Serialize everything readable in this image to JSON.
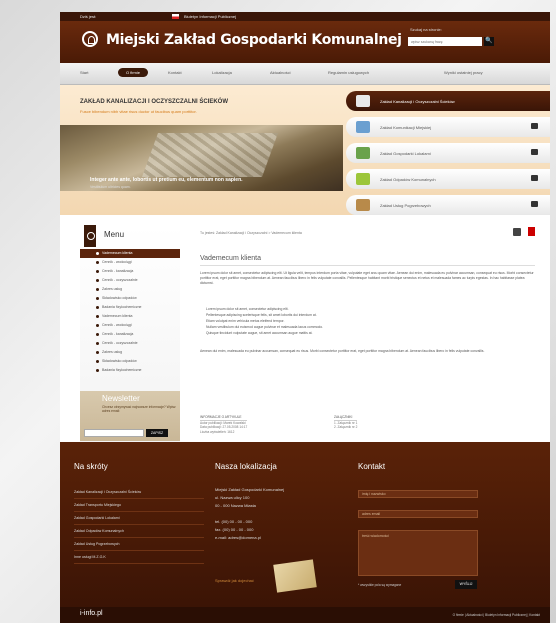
{
  "topbar": {
    "date_label": "Dziś jest:",
    "date_value": "",
    "bip_label": "Biuletyn Informacji Publicznej"
  },
  "header": {
    "title": "Miejski Zakład Gospodarki Komunalnej",
    "search_label": "Szukaj na stronie:",
    "search_placeholder": "wpisz szukaną frazę",
    "search_button": "🔍"
  },
  "nav": [
    "Start",
    "O firmie",
    "Kontakt",
    "Lokalizacja",
    "Aktualności",
    "Regulamin usługowych",
    "Wyniki ostatniej pracy"
  ],
  "slider": {
    "title": "ZAKŁAD KANALIZACJI I OCZYSZCZALNI ŚCIEKÓW",
    "subtitle": "Fusce bibendum nibh vitae risus ductor ut faucibus quam porttitor.",
    "caption": "Integer ante ante, lobortis ut pretium eu, elementum non sapien.",
    "caption_sub": "Vestibulum ultricies quam."
  },
  "tabs": [
    {
      "label": "Zakład Kanalizacji i Oczyszczalni Ścieków",
      "color": "#e8e8e8"
    },
    {
      "label": "Zakład Komunikacji Miejskiej",
      "color": "#6a9fd0"
    },
    {
      "label": "Zakład Gospodarki Lokalami",
      "color": "#6aa24b"
    },
    {
      "label": "Zakład Odpadów Komunalnych",
      "color": "#9cc63a"
    },
    {
      "label": "Zakład Usług Pogrzebowych",
      "color": "#b88a4a"
    }
  ],
  "menu": {
    "title": "Menu",
    "items": [
      "Vademecum klienta",
      "Cennik - wodociągi",
      "Cennik - kanalizacja",
      "Cennik - oczyszczalnie",
      "Zakres usług",
      "Składowisko odpadów",
      "Badania fizykochemiczne",
      "Vademecum klienta",
      "Cennik - wodociągi",
      "Cennik - kanalizacja",
      "Cennik - oczyszczalnie",
      "Zakres usług",
      "Składowisko odpadów",
      "Badania fizykochemiczne"
    ]
  },
  "newsletter": {
    "title": "Newsletter",
    "desc": "Chcesz otrzymywać najnowsze informacje? Wpisz adres email:",
    "button": "ZAPISZ"
  },
  "content": {
    "breadcrumb": "Tu jesteś: Zakład Kanalizacji i Oczyszczalni > Vademecum klienta",
    "title": "Vademecum klienta",
    "p1": "Lorem ipsum dolor sit amet, consectetur adipiscing elit. Ut ligula velit, tempus interdum porta vitae, vulputate eget arcu quam vitae. Aenean dui enim, malesuada eu pulvinar accumsan, consequat eu risus. Morbi consectetur porttitor erat, eget porttitor magna bibendum at. Aenean faucibus libero in felis vulputate convallis. Pellentesque habitant morbi tristique senectus et netus et malesuada fames ac turpis egestas. In hac habitasse platea dictumst.",
    "p2": "Lorem ipsum dolor sit amet, consectetur adipiscing elit.",
    "p3": "Pellentesque adipiscing scelerisque felis, sit amet lobortis dui interdum at.",
    "p4": "Etiam volutpat enim vehicula metus eleifend tempor.",
    "p5": "Nullam vestibulum dui euismod augue pulvinar et malesuada lacus commodo.",
    "p6": "Quisque tincidunt vulputate augue, sit amet accumsan augue mattis at.",
    "p7": "Aenean dui enim, malesuada eu pulvinar accumsan, consequat eu risus. Morbi consectetur porttitor erat, eget porttitor magna bibendum at. Aenean faucibus libero in felis vulputate convallis.",
    "info_title": "INFORMACJE O ARTYKULE",
    "info_rows": [
      "Autor publikacji: Marek Kowalski",
      "Data publikacji: 27.05.2008 14:17",
      "Liczba wyświetleń: 1612"
    ],
    "attach_title": "ZAŁĄCZNIKI",
    "attach_rows": [
      "1. Załącznik nr 1",
      "2. Załącznik nr 2"
    ]
  },
  "footer": {
    "shortcuts_title": "Na skróty",
    "shortcuts": [
      "Zakład Kanalizacji i Oczyszczalni Ścieków",
      "Zakład Transportu Miejskiego",
      "Zakład Gospodarki Lokalami",
      "Zakład Odpadów Komunalnych",
      "Zakład Usług Pogrzebowych",
      "Inne usługi M.Z.G.K"
    ],
    "location_title": "Nasza lokalizacja",
    "address": [
      "Miejski Zakład Gospodarki Komunalnej",
      "ul. Nazwa ulicy 100",
      "00 - 000 Nazwa Miasta",
      "",
      "tel. (00) 00 - 00 - 000",
      "fax. (00) 00 - 00 - 000",
      "e-mail: adres@domena.pl"
    ],
    "map_link": "Sprawdź jak dojechać",
    "contact_title": "Kontakt",
    "f_name": "imię i nazwisko",
    "f_email": "adres email",
    "f_msg": "treść wiadomości",
    "note": "* wszystkie pola są wymagane",
    "send": "WYŚLIJ"
  },
  "bottom": {
    "logo": "i-info.pl",
    "links": "O firmie | Aktualności | Biuletyn Informacji Publicznej | Kontakt"
  }
}
